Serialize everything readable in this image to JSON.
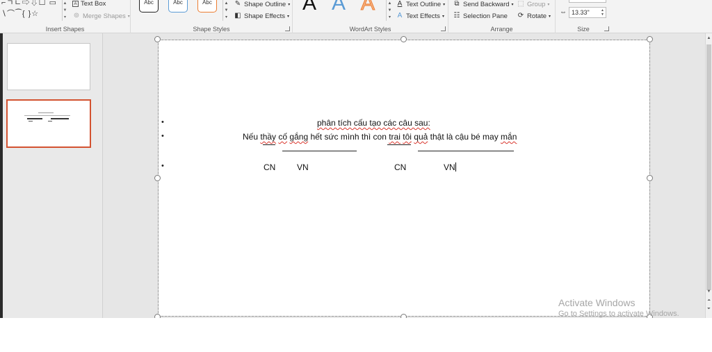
{
  "ribbon": {
    "insert_shapes": {
      "label": "Insert Shapes",
      "row1_glyphs": "⌐ㄱㄴ⇨⇩☐ ▭",
      "row2_glyphs": "∖⌒⁀{ }☆",
      "text_box": "Text Box",
      "merge_shapes": "Merge Shapes"
    },
    "shape_styles": {
      "label": "Shape Styles",
      "preview_text": "Abc",
      "preview_colors": [
        "#222222",
        "#5b9bd5",
        "#ed7d31"
      ],
      "shape_outline": "Shape Outline",
      "shape_effects": "Shape Effects"
    },
    "wordart_styles": {
      "label": "WordArt Styles",
      "letter": "A",
      "letter_colors": [
        "#111111",
        "#5b9bd5",
        "#f4b183"
      ],
      "text_outline": "Text Outline",
      "text_effects": "Text Effects"
    },
    "arrange": {
      "label": "Arrange",
      "send_backward": "Send Backward",
      "selection_pane": "Selection Pane",
      "group": "Group",
      "rotate": "Rotate"
    },
    "size": {
      "label": "Size",
      "width_value": "13.33\""
    }
  },
  "slide": {
    "line1": "phân tích cấu tạo các câu sau:",
    "line2_parts": {
      "a": "Nếu ",
      "b": "thầy",
      "c": " ",
      "d": "cố",
      "e": " ",
      "f": "gắng",
      "g": " hết sức mình thì con ",
      "h": "trai",
      "i": " ",
      "j": "tôi",
      "k": " ",
      "l": "quả",
      "m": " thật là cậu bé may ",
      "n": "mắn"
    },
    "labels": [
      "CN",
      "VN",
      "CN",
      "VN"
    ],
    "bullet_char": "•"
  },
  "watermark": {
    "title": "Activate Windows",
    "subtitle": "Go to Settings to activate Windows."
  },
  "colors": {
    "selected_thumb_border": "#d35230",
    "spelling_underline": "#d9342b"
  }
}
